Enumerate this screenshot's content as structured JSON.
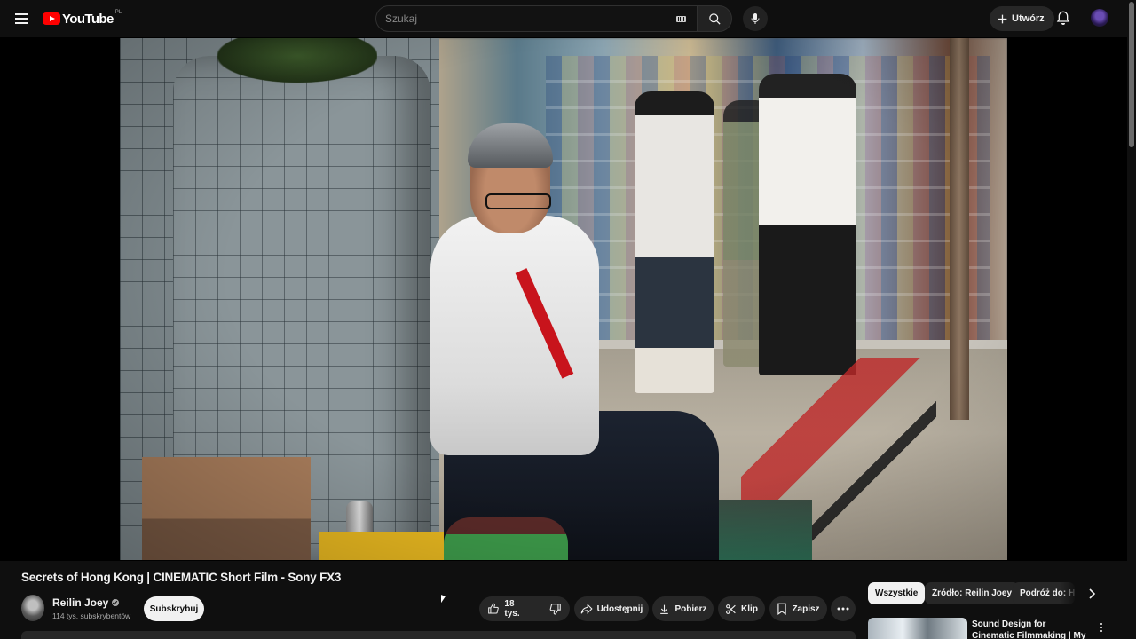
{
  "header": {
    "logo_text": "YouTube",
    "country_code": "PL",
    "search_placeholder": "Szukaj",
    "create_label": "Utwórz"
  },
  "video": {
    "title": "Secrets of Hong Kong | CINEMATIC Short Film - Sony FX3"
  },
  "channel": {
    "name": "Reilin Joey",
    "subscribers": "114 tys. subskrybentów",
    "subscribe_label": "Subskrybuj"
  },
  "actions": {
    "likes": "18 tys.",
    "share_label": "Udostępnij",
    "download_label": "Pobierz",
    "clip_label": "Klip",
    "save_label": "Zapisz"
  },
  "chips": [
    "Wszystkie",
    "Źródło: Reilin Joey",
    "Podróż do: Hong Kong"
  ],
  "recommendations": [
    {
      "title": "Sound Design for Cinematic Filmmaking | My Process"
    }
  ],
  "colors": {
    "background": "#0f0f0f",
    "logo_red": "#ff0000",
    "button_bg": "#272727",
    "subscribe_bg": "#f1f1f1"
  }
}
